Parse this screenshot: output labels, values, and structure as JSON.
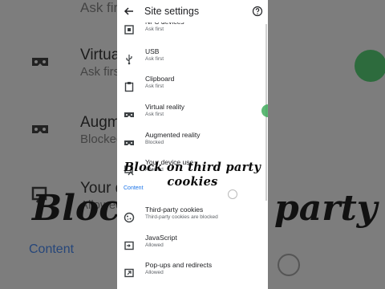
{
  "app_bar": {
    "title": "Site settings",
    "back_icon": "arrow-back-icon",
    "help_icon": "help-circle-icon"
  },
  "items": [
    {
      "icon": "nfc-icon",
      "title": "NFC devices",
      "subtitle": "Ask first"
    },
    {
      "icon": "usb-icon",
      "title": "USB",
      "subtitle": "Ask first"
    },
    {
      "icon": "clipboard-icon",
      "title": "Clipboard",
      "subtitle": "Ask first"
    },
    {
      "icon": "vr-headset-icon",
      "title": "Virtual reality",
      "subtitle": "Ask first"
    },
    {
      "icon": "ar-headset-icon",
      "title": "Augmented reality",
      "subtitle": "Blocked"
    },
    {
      "icon": "device-use-icon",
      "title": "Your device use",
      "subtitle": "Allowed"
    }
  ],
  "section": {
    "label": "Content"
  },
  "content_items": [
    {
      "icon": "cookie-icon",
      "title": "Third-party cookies",
      "subtitle": "Third-party cookies are blocked"
    },
    {
      "icon": "javascript-icon",
      "title": "JavaScript",
      "subtitle": "Allowed"
    },
    {
      "icon": "popup-icon",
      "title": "Pop-ups and redirects",
      "subtitle": "Allowed"
    }
  ],
  "overlay_caption": {
    "line1": "Block on third party",
    "line2": "cookies"
  },
  "background": {
    "rows": [
      {
        "title": "Ask first",
        "subtitle": ""
      },
      {
        "title": "Virtual reality",
        "subtitle": "Ask first"
      },
      {
        "title": "Augmented reality",
        "subtitle": "Blocked"
      },
      {
        "title": "Your device use",
        "subtitle": "Allowed"
      }
    ],
    "section_label": "Content",
    "big_text_left": "Block",
    "big_text_right": "party"
  },
  "colors": {
    "accent": "#1a73e8",
    "background_dim": "#7d7d7d",
    "text_primary": "#202124",
    "text_secondary": "#5f6368"
  }
}
